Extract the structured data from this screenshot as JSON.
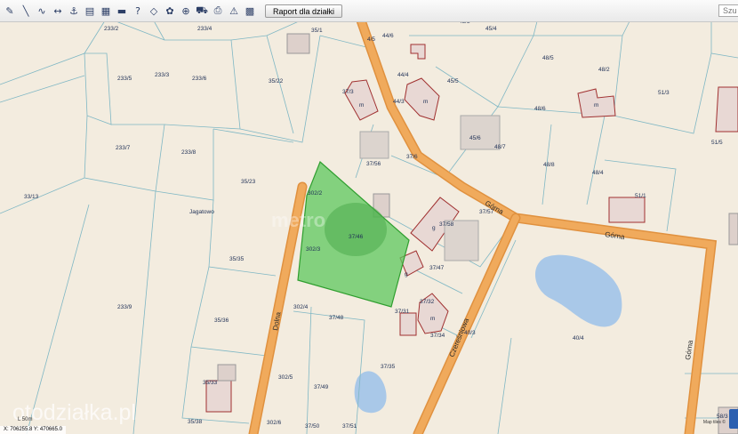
{
  "toolbar": {
    "report_button_label": "Raport dla działki",
    "search_placeholder": "Szu"
  },
  "map": {
    "parcel_labels": [
      "233/2",
      "233/4",
      "35/1",
      "44/6",
      "45/3",
      "45/4",
      "4/5",
      "48/5",
      "233/5",
      "233/3",
      "233/6",
      "35/22",
      "44/4",
      "45/5",
      "48/2",
      "51/3",
      "37/3",
      "44/3",
      "48/6",
      "233/7",
      "233/8",
      "37/56",
      "45/6",
      "48/7",
      "51/5",
      "37/6",
      "48/8",
      "35/23",
      "302/2",
      "48/4",
      "51/1",
      "33/13",
      "37/57",
      "37/58",
      "37/46",
      "35/35",
      "302/3",
      "37/47",
      "302/4",
      "37/48",
      "37/31",
      "37/32",
      "37/34",
      "233/9",
      "35/36",
      "40/3",
      "40/4",
      "37/35",
      "35/33",
      "302/5",
      "37/49",
      "35/38",
      "302/6",
      "37/50",
      "37/51",
      "58/3"
    ],
    "road_names": [
      "Górna",
      "Górna",
      "Górna",
      "Dolna",
      "Czereśniowa"
    ],
    "place_name": "Jagatowo",
    "building_markers": [
      "m",
      "m",
      "m",
      "g",
      "g",
      "m"
    ],
    "coordinates_text": "X: 706255.8   Y: 470665.0",
    "scale_text": "L 50m",
    "watermark": "otodziałka.pl",
    "attribution_text": "Map tiles ©",
    "overlay_text": "metro"
  }
}
